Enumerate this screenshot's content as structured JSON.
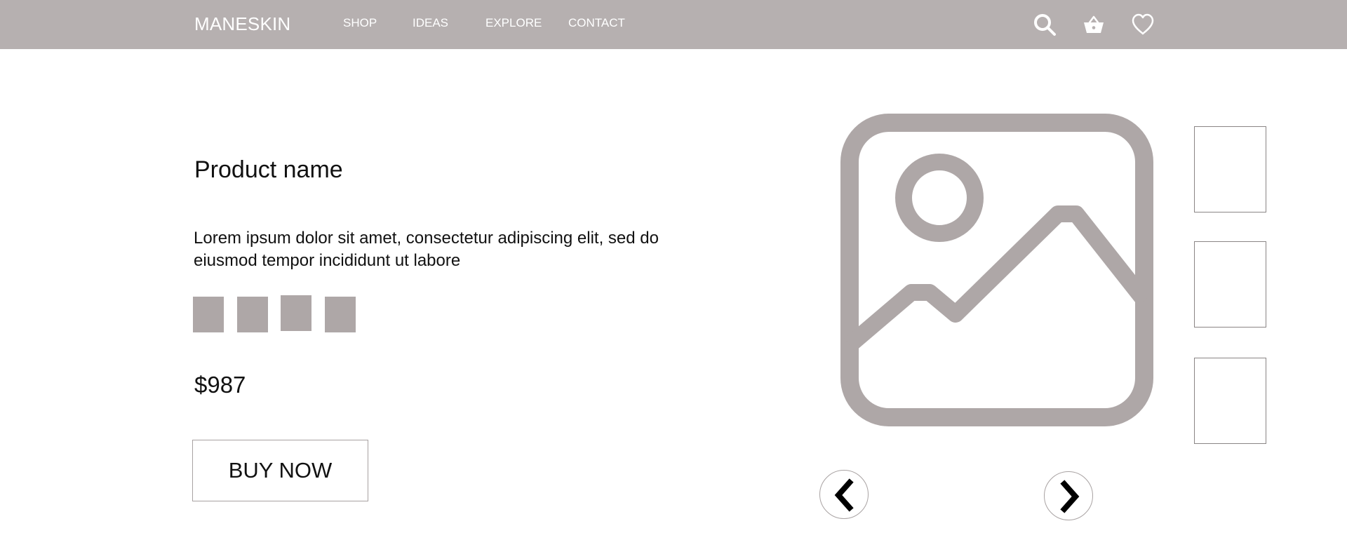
{
  "header": {
    "brand": "MANESKIN",
    "nav": [
      {
        "label": "SHOP"
      },
      {
        "label": "IDEAS"
      },
      {
        "label": "EXPLORE"
      },
      {
        "label": "CONTACT"
      }
    ],
    "icons": [
      "search-icon",
      "basket-icon",
      "heart-icon"
    ]
  },
  "product": {
    "name": "Product name",
    "description": "Lorem ipsum dolor sit amet, consectetur adipiscing elit, sed do eiusmod tempor incididunt ut labore",
    "price": "$987",
    "buy_label": "BUY NOW",
    "swatch_count": 4
  },
  "gallery": {
    "main_image_icon": "image-placeholder-icon",
    "thumbnail_count": 3,
    "prev_icon": "chevron-left-icon",
    "next_icon": "chevron-right-icon"
  },
  "colors": {
    "header_bg": "#b6b0b0",
    "swatch": "#aea7a7",
    "placeholder_icon": "#aea7a7",
    "text": "#111111",
    "header_text": "#ffffff"
  }
}
